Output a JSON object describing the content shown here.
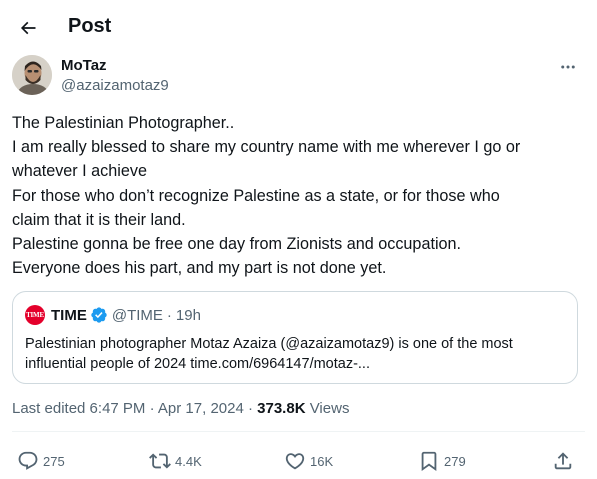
{
  "header": {
    "title": "Post"
  },
  "author": {
    "name": "MoTaz",
    "handle": "@azaizamotaz9"
  },
  "tweet": {
    "lines": [
      "The Palestinian Photographer..",
      "I am really blessed to share my country name with me wherever I go or",
      "whatever I achieve",
      "For those who don’t recognize Palestine as a state, or for those who",
      "claim that it is their land.",
      "Palestine gonna be free one day from Zionists and occupation.",
      "Everyone does his part, and my part is not done yet."
    ]
  },
  "quote": {
    "avatar_text": "TIME",
    "name": "TIME",
    "handle": "@TIME",
    "separator": "·",
    "time": "19h",
    "lines": [
      "Palestinian photographer Motaz Azaiza (@azaizamotaz9) is one of the most",
      "influential people of 2024 time.com/6964147/motaz-..."
    ]
  },
  "meta": {
    "edited": "Last edited 6:47 PM · Apr 17, 2024 · ",
    "views_count": "373.8K",
    "views_label": " Views"
  },
  "actions": {
    "replies": "275",
    "reposts": "4.4K",
    "likes": "16K",
    "bookmarks": "279"
  },
  "colors": {
    "text": "#0f1419",
    "secondary": "#536471",
    "border": "#cfd9de",
    "verified": "#1d9bf0",
    "time_brand": "#e4002b"
  }
}
